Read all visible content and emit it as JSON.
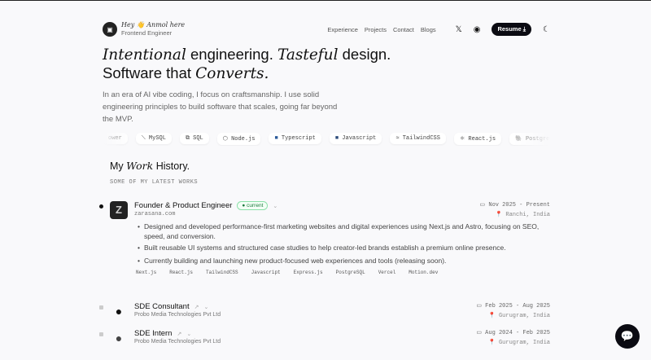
{
  "header": {
    "greeting": "Hey 👋 Anmol here",
    "role": "Frontend Engineer",
    "nav": [
      "Experience",
      "Projects",
      "Contact",
      "Blogs"
    ],
    "resume_label": "Resume ⤓"
  },
  "hero": {
    "w1": "Intentional",
    "w2": " engineering. ",
    "w3": "Tasteful",
    "w4": " design.",
    "w5": "Software that ",
    "w6": "Converts.",
    "paragraph": "In an era of AI vibe coding, I focus on craftsmanship. I use solid engineering principles to build software that scales, going far beyond the MVP."
  },
  "tech": [
    "ower",
    "MySQL",
    "SQL",
    "Node.js",
    "Typescript",
    "Javascript",
    "TailwindCSS",
    "React.js",
    "PostgreSQL"
  ],
  "work": {
    "h_my": "My ",
    "h_work": "Work",
    "h_history": " History.",
    "subtitle": "SOME OF MY LATEST WORKS",
    "jobs": [
      {
        "title": "Founder & Product Engineer",
        "badge": "current",
        "company": "zarasana.com",
        "date": "Nov 2025 - Present",
        "location": "Ranchi, India",
        "bullets": [
          "Designed and developed performance-first marketing websites and digital experiences using Next.js and Astro, focusing on SEO, speed, and conversion.",
          "Built reusable UI systems and structured case studies to help creator-led brands establish a premium online presence.",
          "Currently building and launching new product-focused web experiences and tools (releasing soon)."
        ],
        "tags": [
          "Next.js",
          "React.js",
          "TailwindCSS",
          "Javascript",
          "Express.js",
          "PostgreSQL",
          "Vercel",
          "Motion.dev"
        ]
      },
      {
        "title": "SDE Consultant",
        "company": "Probo Media Technologies Pvt Ltd",
        "date": "Feb 2025 - Aug 2025",
        "location": "Gurugram, India"
      },
      {
        "title": "SDE Intern",
        "company": "Probo Media Technologies Pvt Ltd",
        "date": "Aug 2024 - Feb 2025",
        "location": "Gurugram, India"
      }
    ]
  }
}
